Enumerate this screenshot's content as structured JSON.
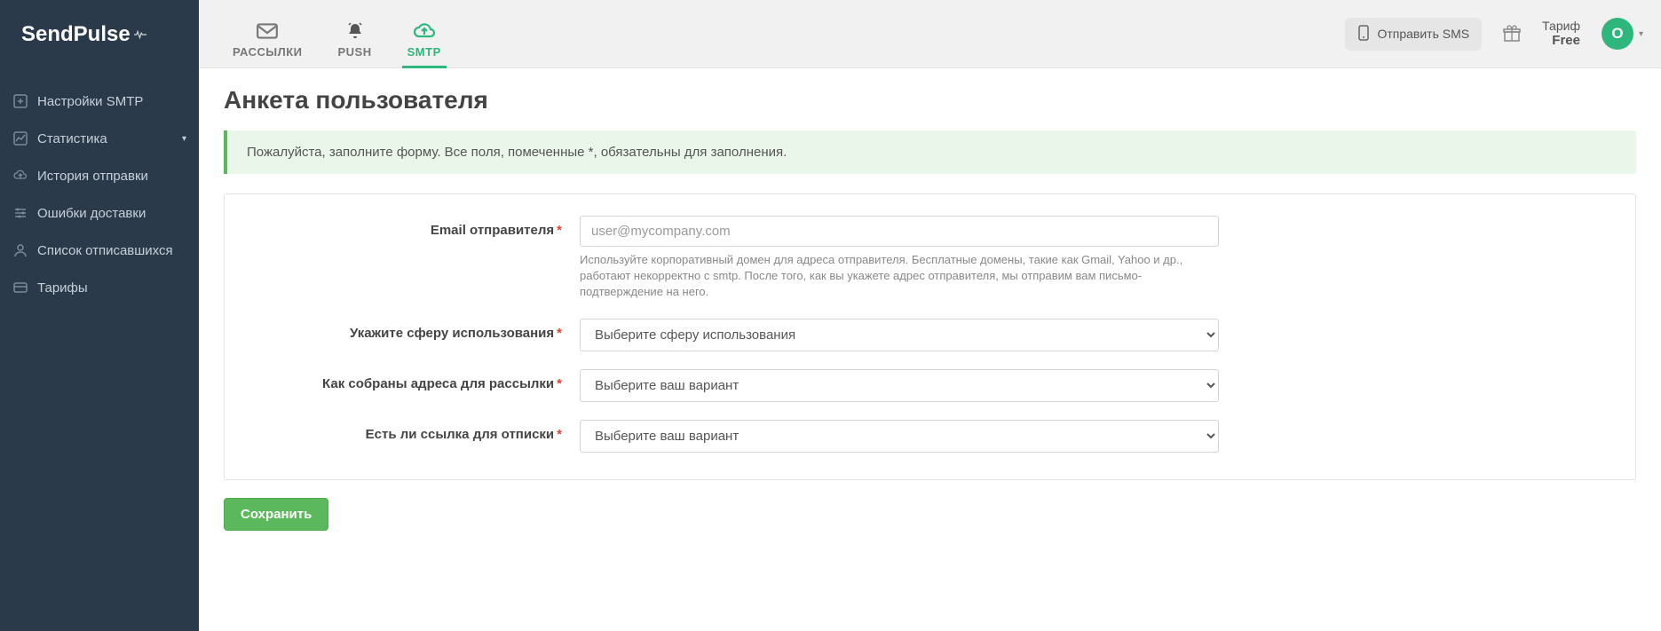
{
  "brand": "SendPulse",
  "topnav": {
    "tabs": [
      {
        "key": "mailings",
        "label": "РАССЫЛКИ"
      },
      {
        "key": "push",
        "label": "PUSH"
      },
      {
        "key": "smtp",
        "label": "SMTP"
      }
    ],
    "sms_button": "Отправить SMS",
    "tariff_label": "Тариф",
    "tariff_value": "Free",
    "avatar_initial": "O"
  },
  "sidebar": {
    "items": [
      {
        "label": "Настройки SMTP"
      },
      {
        "label": "Статистика"
      },
      {
        "label": "История отправки"
      },
      {
        "label": "Ошибки доставки"
      },
      {
        "label": "Список отписавшихся"
      },
      {
        "label": "Тарифы"
      }
    ]
  },
  "page": {
    "title": "Анкета пользователя",
    "alert": "Пожалуйста, заполните форму. Все поля, помеченные *, обязательны для заполнения."
  },
  "form": {
    "email_label": "Email отправителя",
    "email_placeholder": "user@mycompany.com",
    "email_help": "Используйте корпоративный домен для адреса отправителя. Бесплатные домены, такие как Gmail, Yahoo и др., работают некорректно с smtp. После того, как вы укажете адрес отправителя, мы отправим вам письмо-подтверждение на него.",
    "usage_label": "Укажите сферу использования",
    "usage_placeholder": "Выберите сферу использования",
    "source_label": "Как собраны адреса для рассылки",
    "source_placeholder": "Выберите ваш вариант",
    "unsub_label": "Есть ли ссылка для отписки",
    "unsub_placeholder": "Выберите ваш вариант",
    "save_label": "Сохранить"
  },
  "req_mark": "*"
}
